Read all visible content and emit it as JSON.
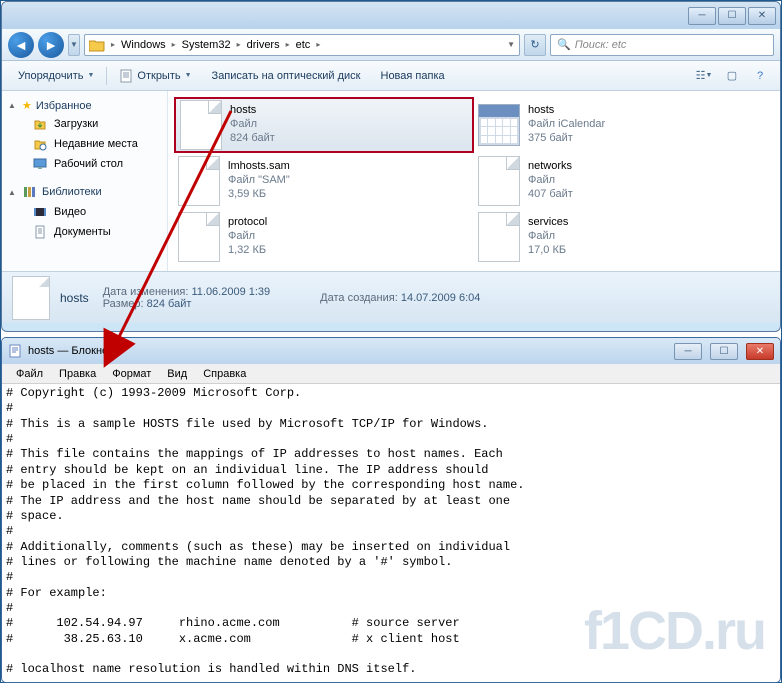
{
  "explorer": {
    "breadcrumb": [
      "Windows",
      "System32",
      "drivers",
      "etc"
    ],
    "search_placeholder": "Поиск: etc",
    "toolbar": {
      "organize": "Упорядочить",
      "open": "Открыть",
      "burn": "Записать на оптический диск",
      "newfolder": "Новая папка"
    },
    "sidebar": {
      "favorites": "Избранное",
      "fav_items": [
        "Загрузки",
        "Недавние места",
        "Рабочий стол"
      ],
      "libraries": "Библиотеки",
      "lib_items": [
        "Видео",
        "Документы"
      ]
    },
    "files": [
      {
        "name": "hosts",
        "type": "Файл",
        "size": "824 байт",
        "icon": "file",
        "selected": true
      },
      {
        "name": "hosts",
        "type": "Файл iCalendar",
        "size": "375 байт",
        "icon": "cal"
      },
      {
        "name": "lmhosts.sam",
        "type": "Файл \"SAM\"",
        "size": "3,59 КБ",
        "icon": "file"
      },
      {
        "name": "networks",
        "type": "Файл",
        "size": "407 байт",
        "icon": "file"
      },
      {
        "name": "protocol",
        "type": "Файл",
        "size": "1,32 КБ",
        "icon": "file"
      },
      {
        "name": "services",
        "type": "Файл",
        "size": "17,0 КБ",
        "icon": "file"
      }
    ],
    "details": {
      "name": "hosts",
      "modified_lbl": "Дата изменения:",
      "modified": "11.06.2009 1:39",
      "created_lbl": "Дата создания:",
      "created": "14.07.2009 6:04",
      "size_lbl": "Размер:",
      "size": "824 байт"
    }
  },
  "notepad": {
    "title": "hosts — Блокнот",
    "menu": [
      "Файл",
      "Правка",
      "Формат",
      "Вид",
      "Справка"
    ],
    "content": "# Copyright (c) 1993-2009 Microsoft Corp.\n#\n# This is a sample HOSTS file used by Microsoft TCP/IP for Windows.\n#\n# This file contains the mappings of IP addresses to host names. Each\n# entry should be kept on an individual line. The IP address should\n# be placed in the first column followed by the corresponding host name.\n# The IP address and the host name should be separated by at least one\n# space.\n#\n# Additionally, comments (such as these) may be inserted on individual\n# lines or following the machine name denoted by a '#' symbol.\n#\n# For example:\n#\n#      102.54.94.97     rhino.acme.com          # source server\n#       38.25.63.10     x.acme.com              # x client host\n\n# localhost name resolution is handled within DNS itself."
  },
  "watermark": "f1CD.ru"
}
